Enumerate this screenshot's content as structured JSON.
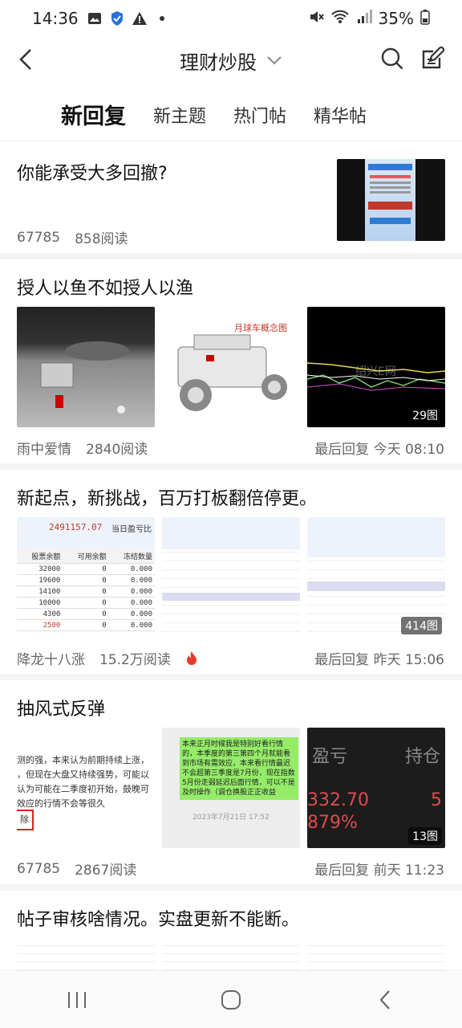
{
  "status": {
    "time": "14:36",
    "battery": "35%"
  },
  "header": {
    "title": "理财炒股"
  },
  "tabs": [
    {
      "label": "新回复",
      "active": true
    },
    {
      "label": "新主题",
      "active": false
    },
    {
      "label": "热门帖",
      "active": false
    },
    {
      "label": "精华帖",
      "active": false
    }
  ],
  "posts": [
    {
      "title": "你能承受大多回撤?",
      "author": "67785",
      "reads": "858阅读"
    },
    {
      "title": "授人以鱼不如授人以渔",
      "author": "雨中爱情",
      "reads": "2840阅读",
      "reply": "最后回复 今天 08:10",
      "img_count": "29图",
      "img2_caption": "月球车概念图",
      "img3_watermark": "绍兴E网"
    },
    {
      "title": "新起点，新挑战，百万打板翻倍停更。",
      "author": "降龙十八涨",
      "reads": "15.2万阅读",
      "reply": "最后回复 昨天 15:06",
      "img_count": "414图",
      "img1": {
        "top_value": "2491157.07",
        "top_label": "当日盈亏比",
        "headers": [
          "股票余额",
          "可用余额",
          "冻结数量"
        ],
        "rows": [
          [
            "32000",
            "0",
            "0.000"
          ],
          [
            "19600",
            "0",
            "0.000"
          ],
          [
            "14100",
            "0",
            "0.000"
          ],
          [
            "10000",
            "0",
            "0.000"
          ],
          [
            "4300",
            "0",
            "0.000"
          ],
          [
            "2500",
            "0",
            "0.000"
          ]
        ]
      }
    },
    {
      "title": "抽风式反弹",
      "author": "67785",
      "reads": "2867阅读",
      "reply": "最后回复 前天 11:23",
      "img_count": "13图",
      "img1_text": [
        "测的强，本来认为前期持续上涨，",
        "，但现在大盘又持续强势，可能以",
        "认为可能在二季度初开始，鼓晚可",
        "效应的行情不会等很久"
      ],
      "img1_mark": "除",
      "img2_text": "本来正月时候我是特别好看行情的，本季度的第三第四个月就能看到市场有需效应，本来看行情最迟不会超第三季度是7月份，现在指数5月份走弱延迟后面行情，可以不是及时操作（调仓换股正正收益",
      "img2_date": "2023年7月21日 17:52",
      "img3": {
        "l1": "盈亏",
        "r1": "持仓",
        "v1": "332.70",
        "v2": "879%",
        "r2": "5"
      }
    },
    {
      "title": "帖子审核啥情况。实盘更新不能断。"
    }
  ]
}
